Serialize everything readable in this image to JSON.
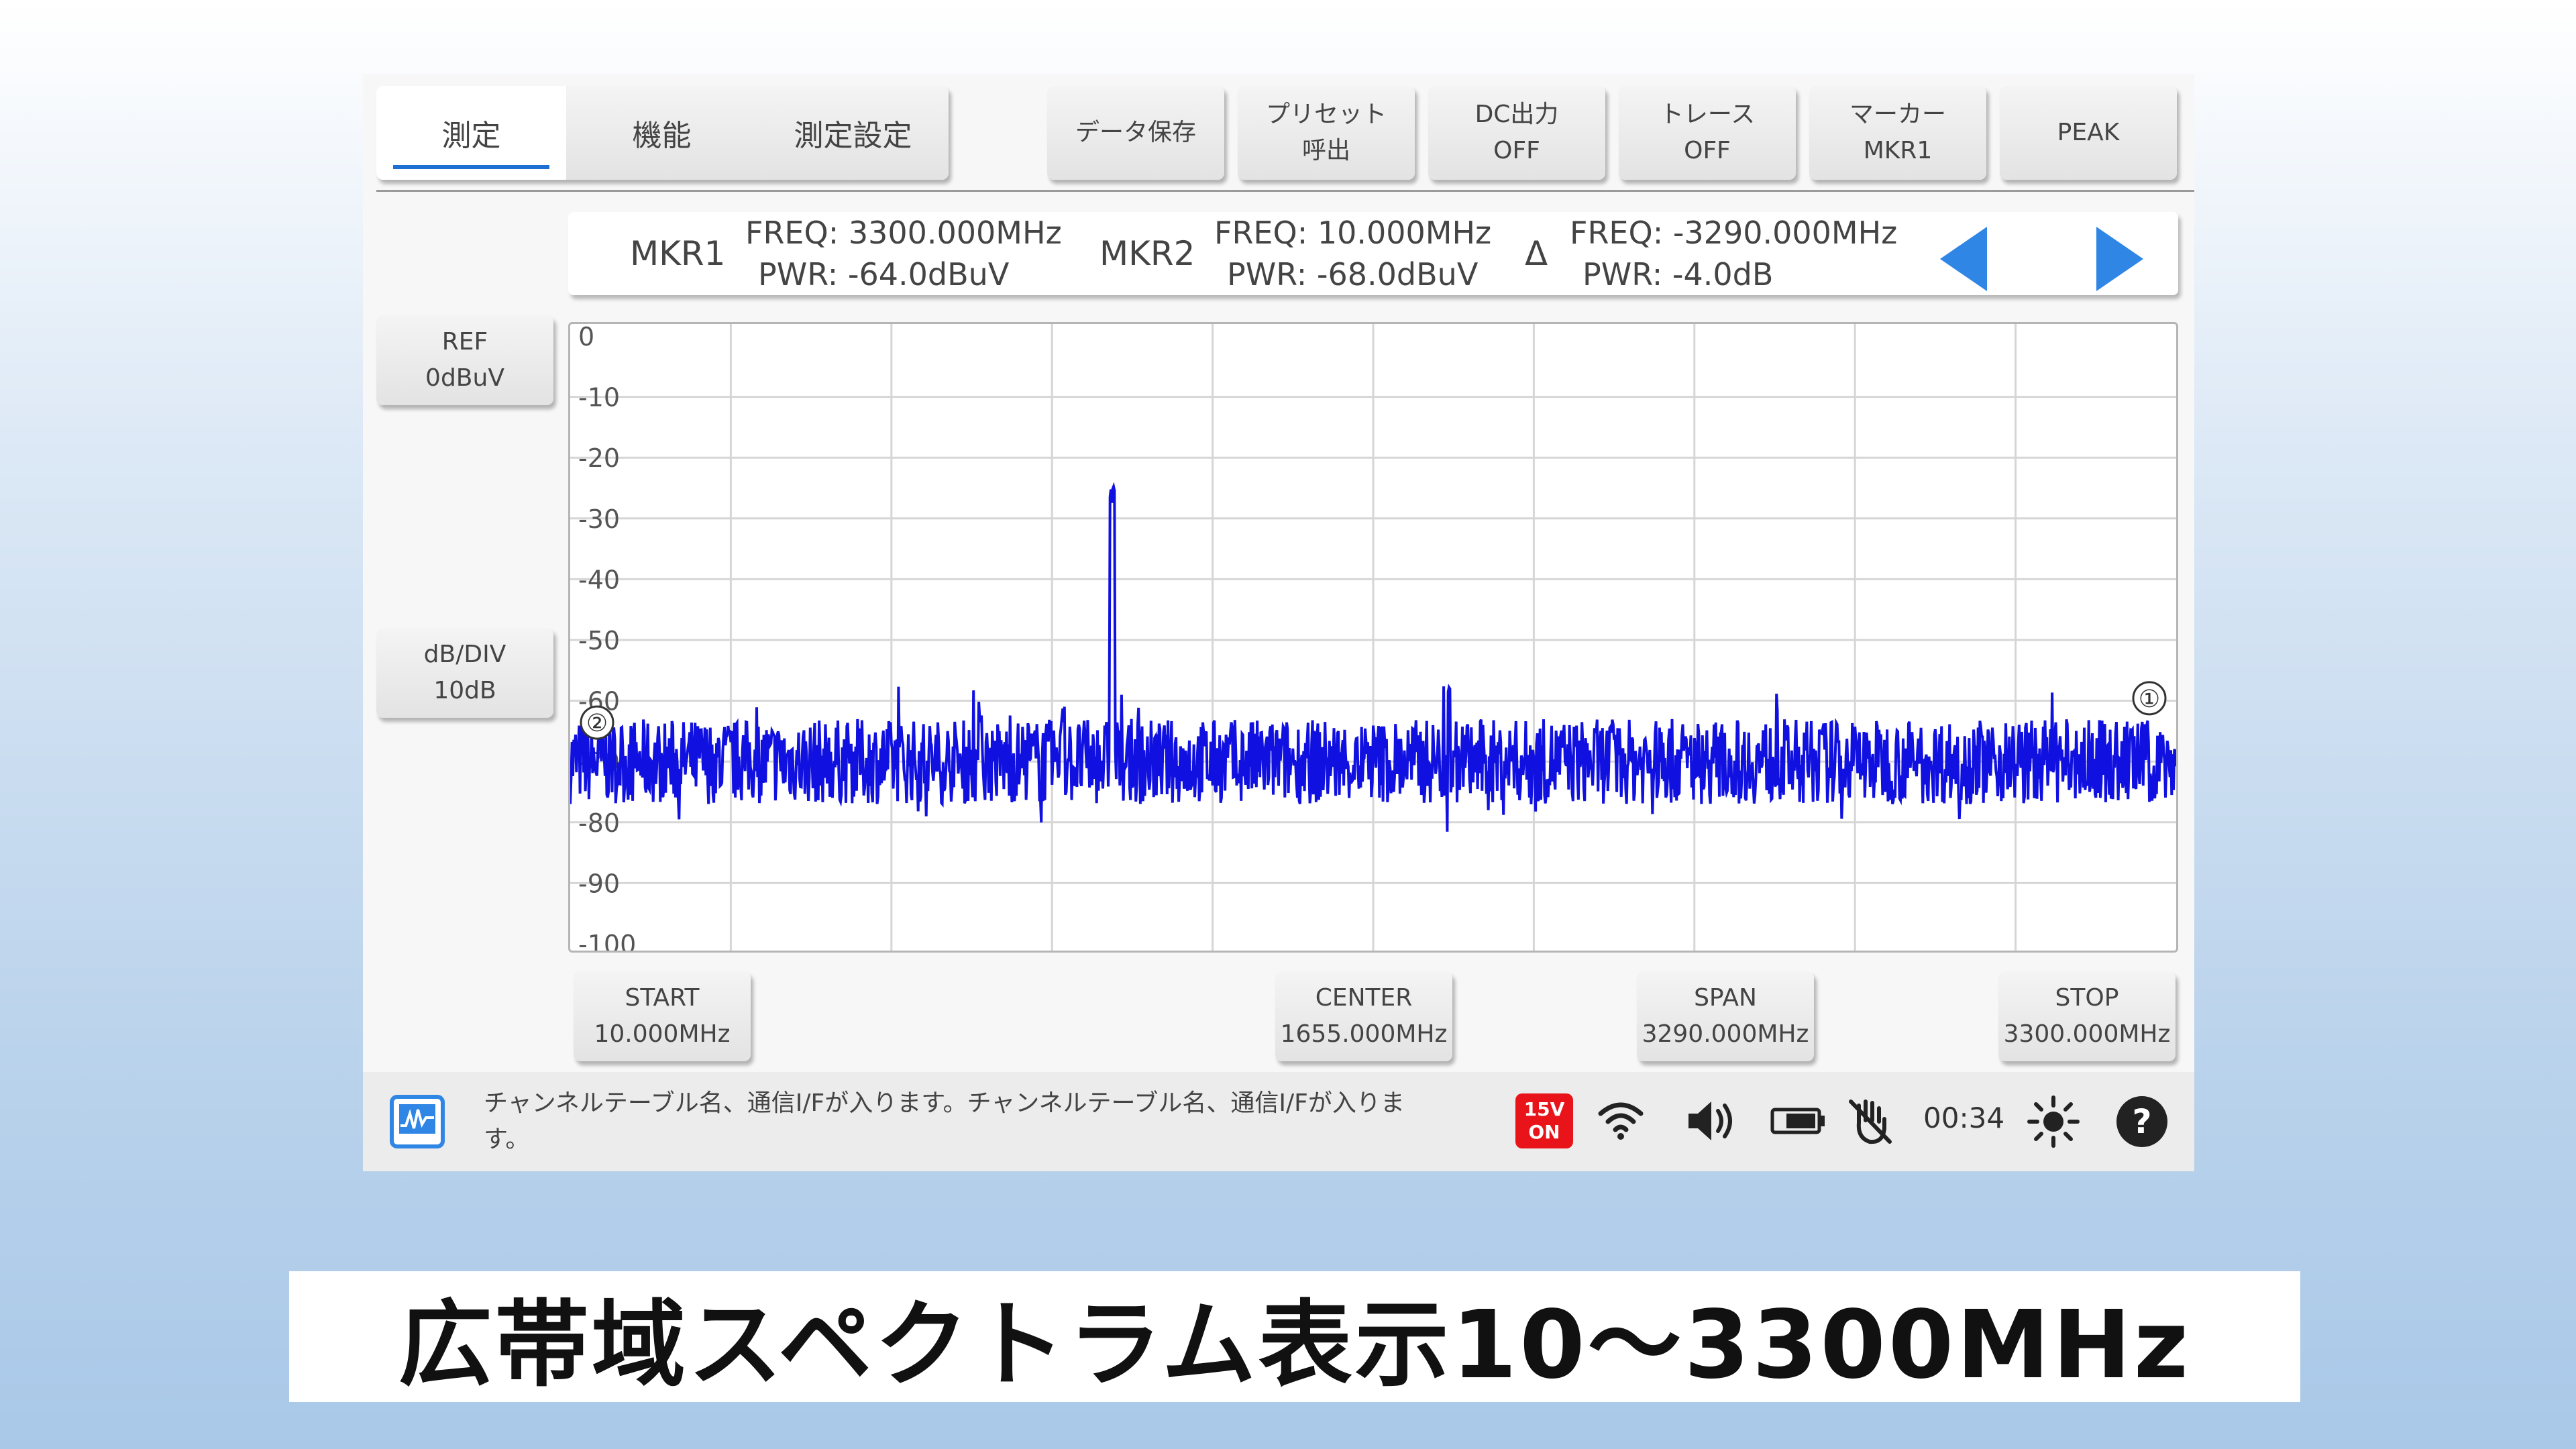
{
  "tabs": [
    {
      "label": "測定",
      "active": true
    },
    {
      "label": "機能",
      "active": false
    },
    {
      "label": "測定設定",
      "active": false
    }
  ],
  "toolbar": {
    "save": {
      "line1": "データ保存"
    },
    "preset": {
      "line1": "プリセット",
      "line2": "呼出"
    },
    "dc": {
      "line1": "DC出力",
      "line2": "OFF"
    },
    "trace": {
      "line1": "トレース",
      "line2": "OFF"
    },
    "marker": {
      "line1": "マーカー",
      "line2": "MKR1"
    },
    "peak": {
      "line1": "PEAK"
    }
  },
  "markers": {
    "mkr1": {
      "name": "MKR1",
      "freq": "FREQ: 3300.000MHz",
      "pwr": "PWR: -64.0dBuV"
    },
    "mkr2": {
      "name": "MKR2",
      "freq": "FREQ: 10.000MHz",
      "pwr": "PWR: -68.0dBuV"
    },
    "delta": {
      "name": "Δ",
      "freq": "FREQ: -3290.000MHz",
      "pwr": "PWR: -4.0dB"
    }
  },
  "side": {
    "ref": {
      "line1": "REF",
      "line2": "0dBuV"
    },
    "dbdiv": {
      "line1": "dB/DIV",
      "line2": "10dB"
    }
  },
  "bottom": {
    "start": {
      "line1": "START",
      "line2": "10.000MHz"
    },
    "center": {
      "line1": "CENTER",
      "line2": "1655.000MHz"
    },
    "span": {
      "line1": "SPAN",
      "line2": "3290.000MHz"
    },
    "stop": {
      "line1": "STOP",
      "line2": "3300.000MHz"
    }
  },
  "chart_data": {
    "type": "line",
    "x_unit": "MHz",
    "x_range": [
      10,
      3300
    ],
    "ylim": [
      -100,
      0
    ],
    "y_ticks": [
      "0",
      "-10",
      "-20",
      "-30",
      "-40",
      "-50",
      "-60",
      "-70",
      "-80",
      "-90",
      "-100"
    ],
    "grid": true,
    "noise_floor_dbuv": -70,
    "peaks": [
      {
        "x": 1120,
        "y": -26
      },
      {
        "x": 1810,
        "y": -57
      },
      {
        "x": 1020,
        "y": -62
      },
      {
        "x": 850,
        "y": -62
      }
    ],
    "markers": [
      {
        "label": "①",
        "x": 3300,
        "y": -64
      },
      {
        "label": "②",
        "x": 10,
        "y": -68
      }
    ],
    "trace_color": "#1010e0"
  },
  "status": {
    "channel_text": "チャンネルテーブル名、通信I/Fが入ります。チャンネルテーブル名、通信I/Fが入ります。",
    "dc_badge_line1": "15V",
    "dc_badge_line2": "ON",
    "time": "00:34",
    "help": "?"
  },
  "caption": "広帯域スペクトラム表示10～3300MHz"
}
